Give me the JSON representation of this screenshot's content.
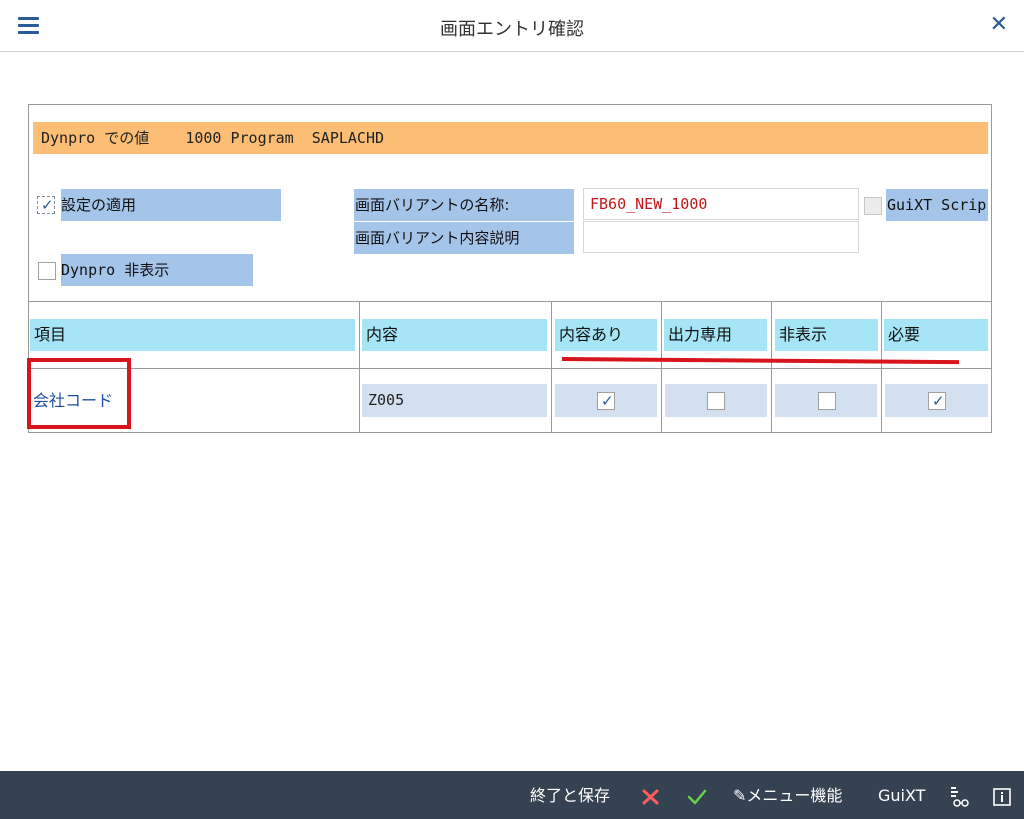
{
  "window": {
    "title": "画面エントリ確認"
  },
  "dynpro": {
    "label": "Dynpro での値    1000 Program  SAPLACHD"
  },
  "settings": {
    "apply_label": "設定の適用",
    "apply_checked": true,
    "dynpro_hide_label": "Dynpro 非表示",
    "dynpro_hide_checked": false,
    "variant_name_label": "画面バリアントの名称:",
    "variant_name_value": "FB60_NEW_1000",
    "variant_desc_label": "画面バリアント内容説明",
    "variant_desc_value": "",
    "guixt_label": "GuiXT Scrip",
    "guixt_checked": false
  },
  "table": {
    "headers": {
      "item": "項目",
      "content": "内容",
      "has_content": "内容あり",
      "output_only": "出力専用",
      "hidden": "非表示",
      "required": "必要"
    },
    "rows": [
      {
        "item": "会社コード",
        "content": "Z005",
        "has_content": true,
        "output_only": false,
        "hidden": false,
        "required": true
      }
    ]
  },
  "footer": {
    "save_exit": "終了と保存",
    "menu_functions": "メニュー機能",
    "guixt": "GuiXT"
  },
  "colors": {
    "dynpro_bar": "#fcbd74",
    "label_blue": "#a5c4ea",
    "header_cyan": "#a6e5f5",
    "annotation_red": "#d8141c",
    "footer_bg": "#354252"
  }
}
